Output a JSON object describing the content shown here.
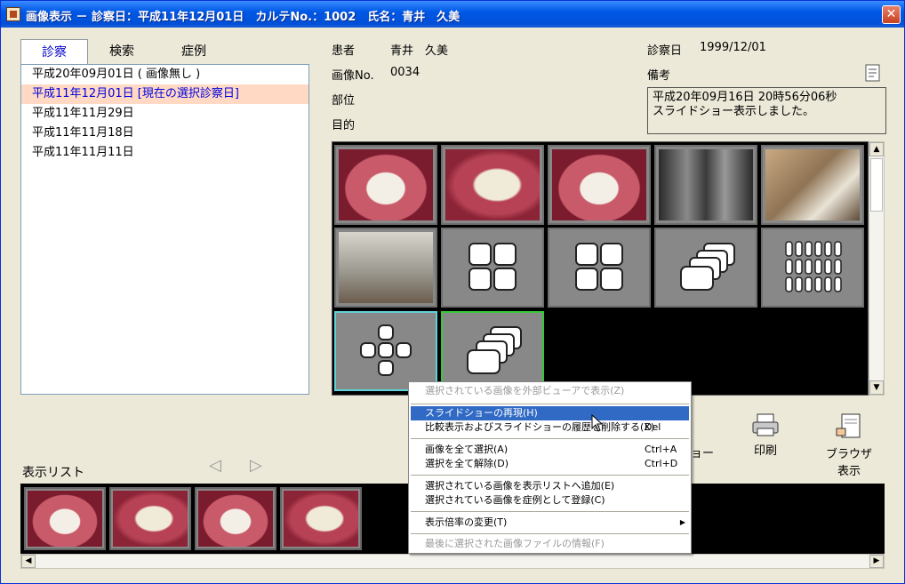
{
  "window": {
    "title": "画像表示 － 診察日：平成11年12月01日　カルテNo.：1002　氏名：青井　久美",
    "close_label": "✕"
  },
  "tabs": [
    "診察",
    "検索",
    "症例"
  ],
  "exam_dates": [
    "平成20年09月01日 ( 画像無し )",
    "平成11年12月01日 [現在の選択診察日]",
    "平成11年11月29日",
    "平成11年11月18日",
    "平成11年11月11日"
  ],
  "patient": {
    "patient_label": "患者",
    "patient_value": "青井　久美",
    "image_no_label": "画像No.",
    "image_no_value": "0034",
    "site_label": "部位",
    "purpose_label": "目的",
    "exam_date_label": "診察日",
    "exam_date_value": "1999/12/01",
    "remarks_label": "備考",
    "remarks_line1": "平成20年09月16日 20時56分06秒",
    "remarks_line2": "スライドショー表示しました。"
  },
  "grid": {
    "cells": [
      {
        "kind": "photo",
        "icon": "teeth-photo"
      },
      {
        "kind": "photo",
        "icon": "teeth-photo"
      },
      {
        "kind": "photo",
        "icon": "open-mouth-photo"
      },
      {
        "kind": "photo",
        "icon": "xray-photo"
      },
      {
        "kind": "photo",
        "icon": "clinic-room-photo"
      },
      {
        "kind": "photo",
        "icon": "clinic-room-photo"
      },
      {
        "kind": "icon",
        "icon": "four-grid-icon"
      },
      {
        "kind": "icon",
        "icon": "four-grid-icon"
      },
      {
        "kind": "icon",
        "icon": "slideshow-stack-icon"
      },
      {
        "kind": "icon",
        "icon": "many-grid-icon"
      },
      {
        "kind": "icon",
        "icon": "cross-layout-icon"
      },
      {
        "kind": "icon",
        "icon": "slideshow-stack-icon"
      }
    ]
  },
  "toolbar": {
    "slideshow_label": "ョー",
    "print_label": "印刷",
    "browser_label_line1": "ブラウザ",
    "browser_label_line2": "表示"
  },
  "display_list": {
    "label": "表示リスト",
    "thumbnails": [
      "teeth-front-photo",
      "teeth-side-photo",
      "upper-jaw-photo",
      "lower-jaw-photo"
    ]
  },
  "context_menu": {
    "items": [
      {
        "label": "選択されている画像を外部ビューアで表示(Z)",
        "shortcut": "",
        "disabled": true
      },
      {
        "label": "スライドショーの再現(H)",
        "shortcut": "",
        "hover": true
      },
      {
        "label": "比較表示およびスライドショーの履歴を削除する(X)",
        "shortcut": "Del"
      },
      {
        "label": "画像を全て選択(A)",
        "shortcut": "Ctrl+A"
      },
      {
        "label": "選択を全て解除(D)",
        "shortcut": "Ctrl+D"
      },
      {
        "label": "選択されている画像を表示リストへ追加(E)",
        "shortcut": ""
      },
      {
        "label": "選択されている画像を症例として登録(C)",
        "shortcut": ""
      },
      {
        "label": "表示倍率の変更(T)",
        "shortcut": "",
        "submenu": true
      },
      {
        "label": "最後に選択された画像ファイルの情報(F)",
        "shortcut": "",
        "disabled": true
      }
    ]
  }
}
